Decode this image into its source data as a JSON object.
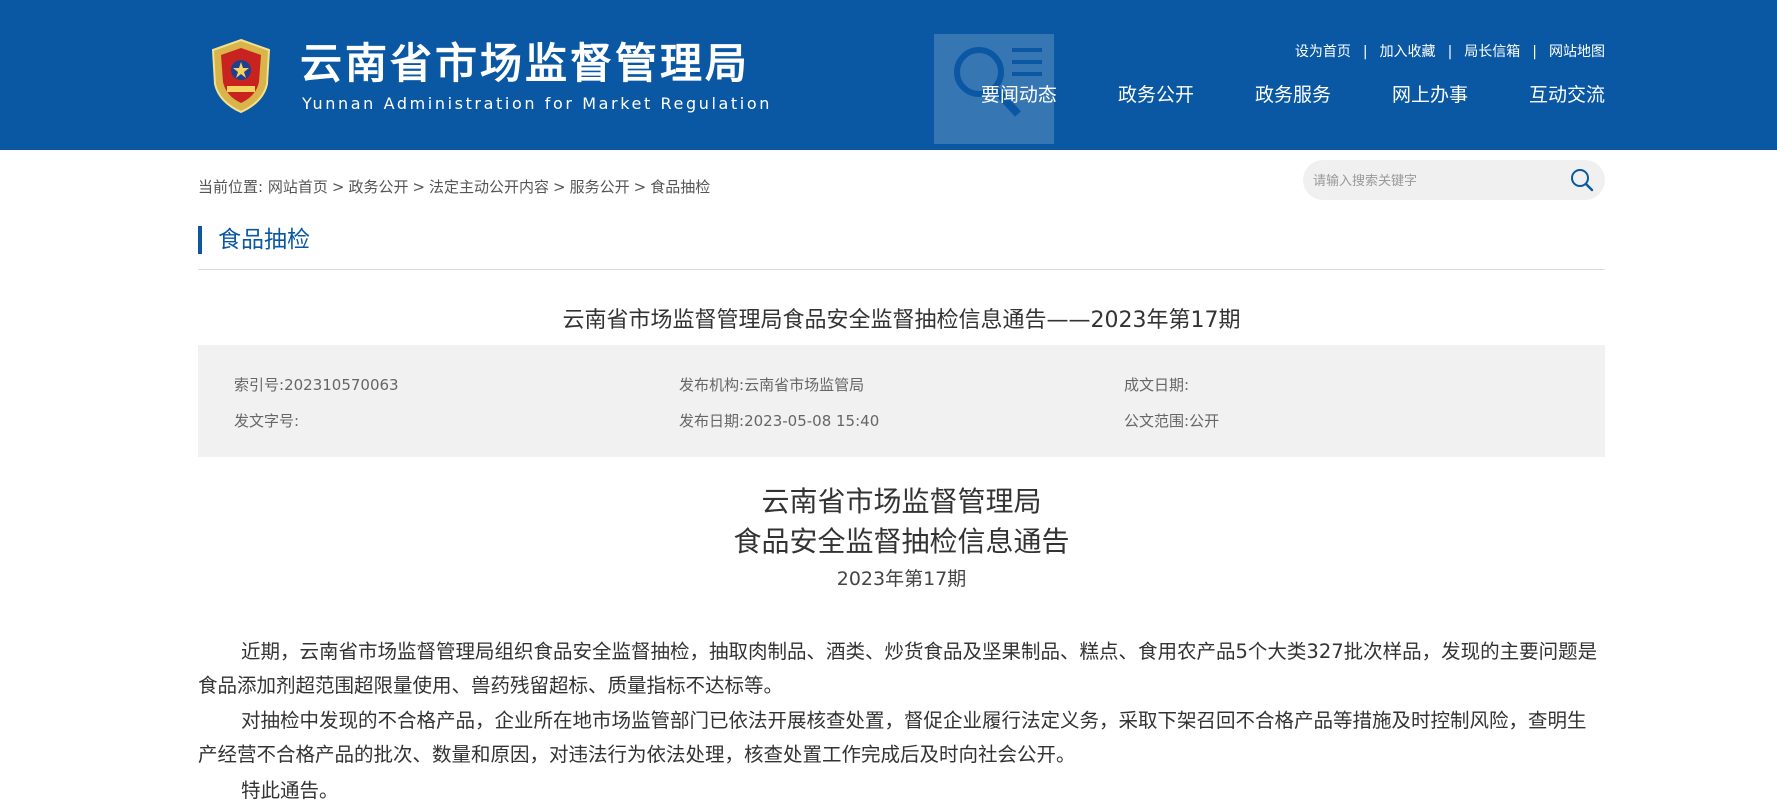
{
  "header": {
    "logo_cn": "云南省市场监督管理局",
    "logo_en": "Yunnan Administration for Market Regulation",
    "brand_color": "#0a58a3",
    "top_links": [
      "设为首页",
      "加入收藏",
      "局长信箱",
      "网站地图"
    ],
    "nav": [
      "要闻动态",
      "政务公开",
      "政务服务",
      "网上办事",
      "互动交流"
    ]
  },
  "breadcrumb": {
    "prefix": "当前位置:",
    "items": [
      "网站首页",
      "政务公开",
      "法定主动公开内容",
      "服务公开",
      "食品抽检"
    ]
  },
  "search": {
    "placeholder": "请输入搜索关键字",
    "value": ""
  },
  "section": {
    "title": "食品抽检"
  },
  "article": {
    "title": "云南省市场监督管理局食品安全监督抽检信息通告——2023年第17期",
    "meta": {
      "index_label": "索引号:",
      "index_value": "202310570063",
      "publisher_label": "发布机构:",
      "publisher_value": "云南省市场监管局",
      "written_label": "成文日期:",
      "written_value": "",
      "docno_label": "发文字号:",
      "docno_value": "",
      "date_label": "发布日期:",
      "date_value": "2023-05-08 15:40",
      "scope_label": "公文范围:",
      "scope_value": "公开"
    },
    "heading_line1": "云南省市场监督管理局",
    "heading_line2": "食品安全监督抽检信息通告",
    "heading_issue": "2023年第17期",
    "paragraphs": [
      "近期，云南省市场监督管理局组织食品安全监督抽检，抽取肉制品、酒类、炒货食品及坚果制品、糕点、食用农产品5个大类327批次样品，发现的主要问题是食品添加剂超范围超限量使用、兽药残留超标、质量指标不达标等。",
      "对抽检中发现的不合格产品，企业所在地市场监管部门已依法开展核查处置，督促企业履行法定义务，采取下架召回不合格产品等措施及时控制风险，查明生产经营不合格产品的批次、数量和原因，对违法行为依法处理，核查处置工作完成后及时向社会公开。",
      "特此通告。"
    ]
  }
}
